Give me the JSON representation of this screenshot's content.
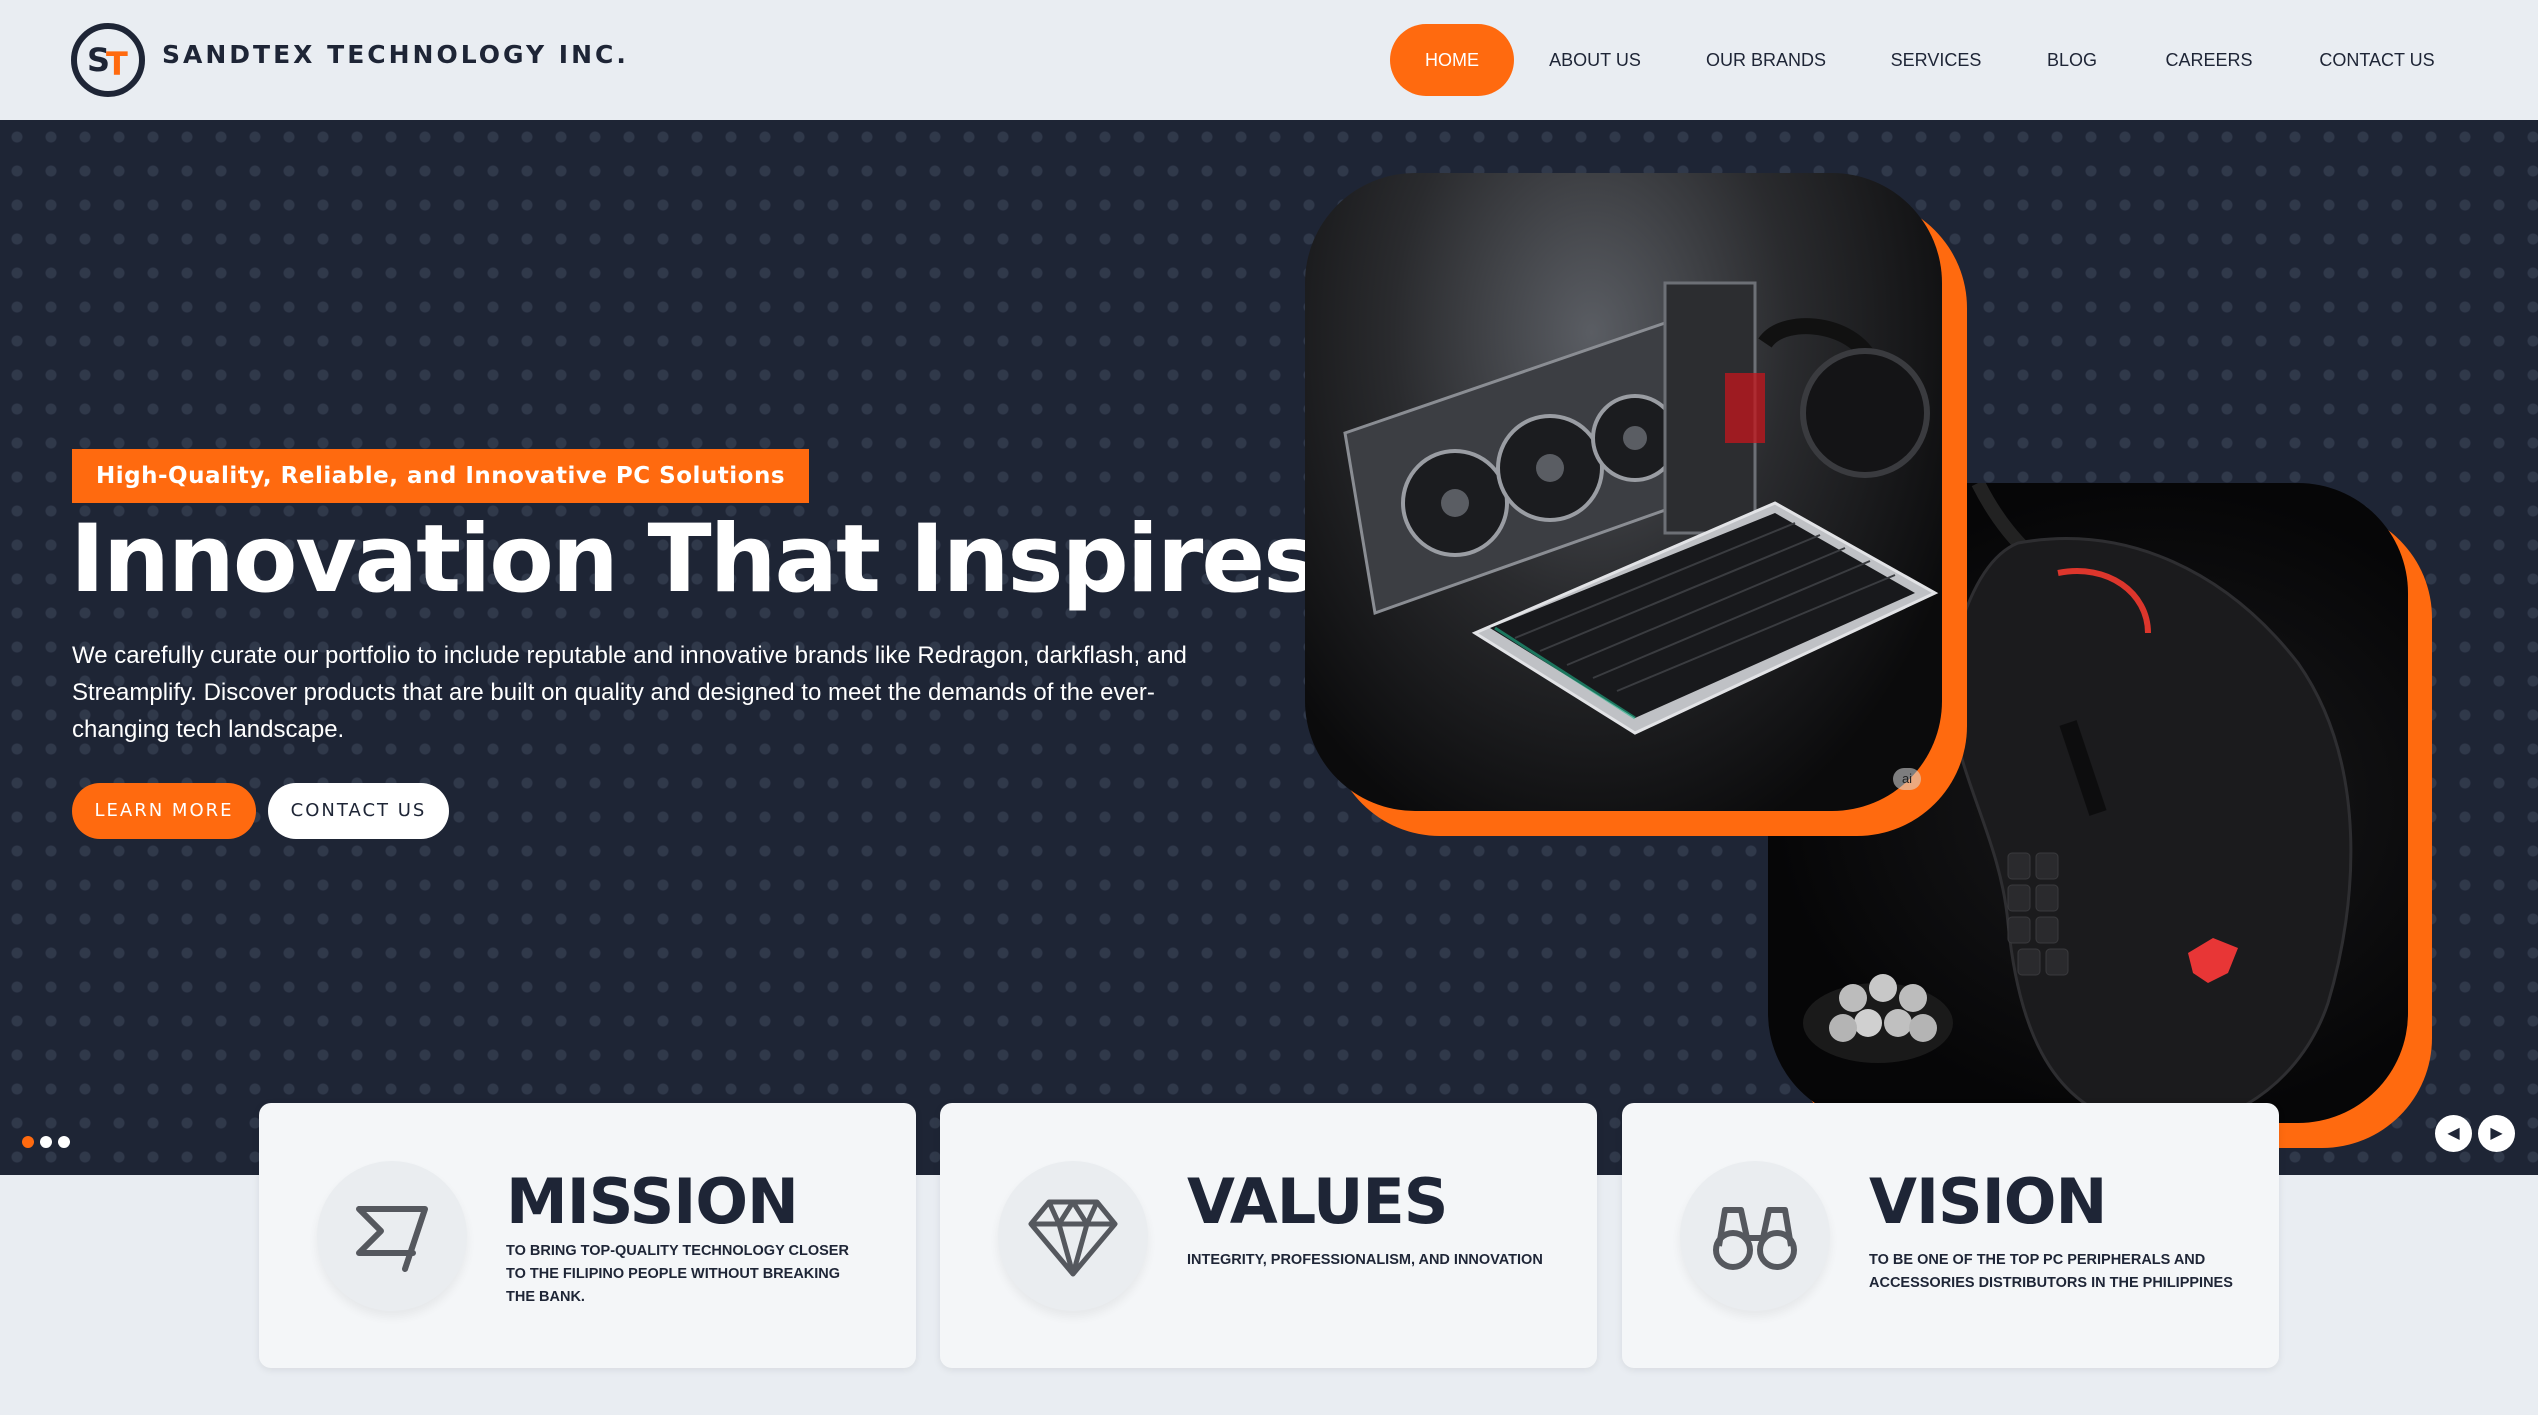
{
  "header": {
    "logo_letters": "ST",
    "brand_name": "SANDTEX TECHNOLOGY INC.",
    "nav": [
      {
        "label": "HOME",
        "active": true
      },
      {
        "label": "ABOUT US",
        "active": false
      },
      {
        "label": "OUR BRANDS",
        "active": false
      },
      {
        "label": "SERVICES",
        "active": false
      },
      {
        "label": "BLOG",
        "active": false
      },
      {
        "label": "CAREERS",
        "active": false
      },
      {
        "label": "CONTACT US",
        "active": false
      }
    ]
  },
  "hero": {
    "tagline": "High-Quality, Reliable, and Innovative PC Solutions",
    "title": "Innovation That Inspires",
    "description": "We carefully curate our portfolio to include reputable and innovative brands like Redragon, darkflash, and Streamplify. Discover products that are built on quality and designed to meet the demands of the ever-changing tech landscape.",
    "learn_more": "LEARN MORE",
    "contact_us": "CONTACT US",
    "image_badge": "ai",
    "slides_total": 3,
    "slide_active": 1
  },
  "cards": [
    {
      "title": "MISSION",
      "text": "TO BRING TOP-QUALITY TECHNOLOGY CLOSER TO THE FILIPINO PEOPLE WITHOUT BREAKING THE BANK.",
      "icon": "flag-icon"
    },
    {
      "title": "VALUES",
      "text": "INTEGRITY, PROFESSIONALISM, AND INNOVATION",
      "icon": "diamond-icon"
    },
    {
      "title": "VISION",
      "text": "TO BE ONE OF THE TOP PC PERIPHERALS AND ACCESSORIES DISTRIBUTORS IN THE PHILIPPINES",
      "icon": "binoculars-icon"
    }
  ],
  "colors": {
    "accent": "#ff6a0f",
    "dark": "#1e2535",
    "header_bg": "#e9edf2",
    "card_bg": "#f4f6f8"
  }
}
